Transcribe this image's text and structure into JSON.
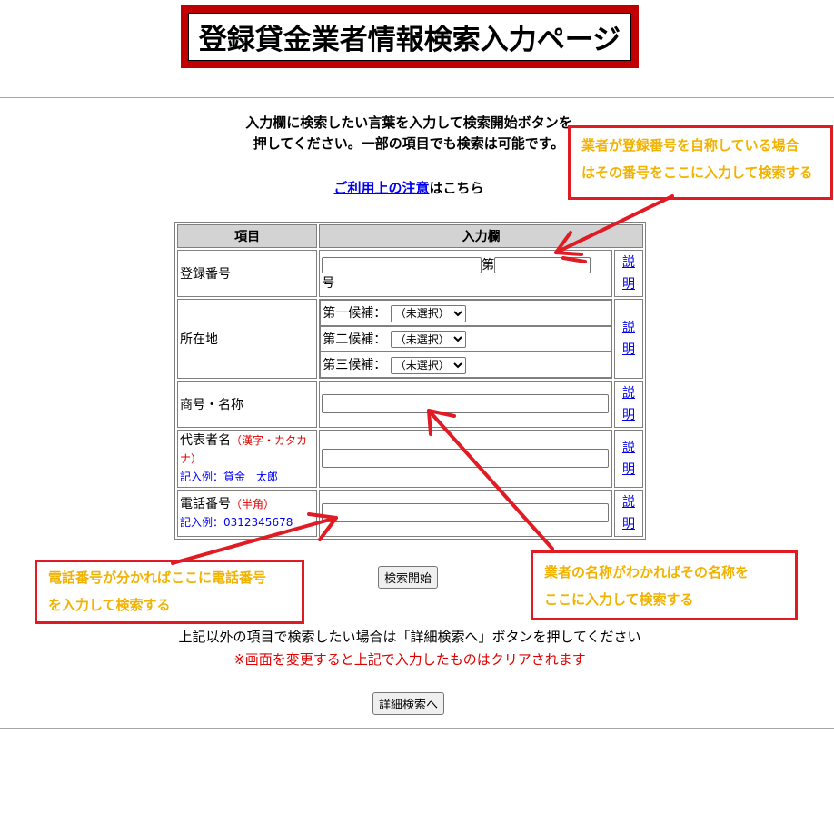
{
  "page": {
    "title": "登録貸金業者情報検索入力ページ",
    "instructions_line1": "入力欄に検索したい言葉を入力して検索開始ボタンを",
    "instructions_line2": "押してください。一部の項目でも検索は可能です。",
    "notice_link": "ご利用上の注意",
    "notice_suffix": "はこちら"
  },
  "table": {
    "header_item": "項目",
    "header_input": "入力欄",
    "explain_link_line1": "説",
    "explain_link_line2": "明",
    "registration": {
      "label": "登録番号",
      "prefix_value": "",
      "dai": "第",
      "number_value": "",
      "go": "号"
    },
    "location": {
      "label": "所在地",
      "candidate1": "第一候補：",
      "candidate2": "第二候補：",
      "candidate3": "第三候補：",
      "select_value": "（未選択）"
    },
    "trade_name": {
      "label": "商号・名称",
      "value": ""
    },
    "representative": {
      "label": "代表者名",
      "note": "（漢字・カタカナ）",
      "example": "記入例：貸金　太郎",
      "value": ""
    },
    "phone": {
      "label": "電話番号",
      "note": "（半角）",
      "example": "記入例：0312345678",
      "value": ""
    }
  },
  "buttons": {
    "search_start": "検索開始",
    "detail_search": "詳細検索へ"
  },
  "messages": {
    "other_items": "上記以外の項目で検索したい場合は「詳細検索へ」ボタンを押してください",
    "clear_warning": "※画面を変更すると上記で入力したものはクリアされます"
  },
  "annotations": {
    "registration_callout_line1": "業者が登録番号を自称している場合",
    "registration_callout_line2": "はその番号をここに入力して検索する",
    "phone_callout_line1": "電話番号が分かればここに電話番号",
    "phone_callout_line2": "を入力して検索する",
    "name_callout_line1": "業者の名称がわかればその名称を",
    "name_callout_line2": "ここに入力して検索する"
  },
  "colors": {
    "title_border": "#c00000",
    "callout_border": "#e01b24",
    "callout_text": "#f2b200",
    "link": "#0000ee",
    "warning": "#e00000",
    "example": "#0000ff"
  }
}
